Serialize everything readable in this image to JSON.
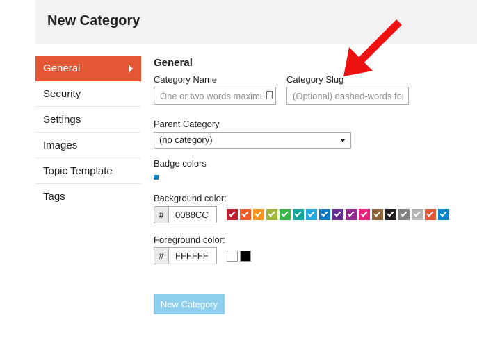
{
  "header": {
    "title": "New Category"
  },
  "sidebar": {
    "items": [
      {
        "label": "General"
      },
      {
        "label": "Security"
      },
      {
        "label": "Settings"
      },
      {
        "label": "Images"
      },
      {
        "label": "Topic Template"
      },
      {
        "label": "Tags"
      }
    ]
  },
  "general": {
    "title": "General",
    "category_name": {
      "label": "Category Name",
      "placeholder": "One or two words maximum"
    },
    "category_slug": {
      "label": "Category Slug",
      "placeholder": "(Optional) dashed-words for url"
    },
    "parent_category": {
      "label": "Parent Category",
      "selected": "(no category)"
    },
    "badge_colors": {
      "label": "Badge colors",
      "preview_color": "#0088CC"
    },
    "background_color": {
      "label": "Background color:",
      "hash": "#",
      "value": "0088CC",
      "swatches": [
        "#BF1E2E",
        "#F1592A",
        "#F7941D",
        "#9EB83B",
        "#3AB54A",
        "#12A89D",
        "#25AAE2",
        "#0E76BD",
        "#652D90",
        "#92278F",
        "#ED207B",
        "#8C6238",
        "#231F20",
        "#808281",
        "#B3B5B4",
        "#E45735",
        "#0088CC"
      ]
    },
    "foreground_color": {
      "label": "Foreground color:",
      "hash": "#",
      "value": "FFFFFF",
      "swatches": [
        "#FFFFFF",
        "#000000"
      ]
    },
    "submit_label": "New Category"
  },
  "annotation": {
    "arrow_color": "#EE1111"
  }
}
